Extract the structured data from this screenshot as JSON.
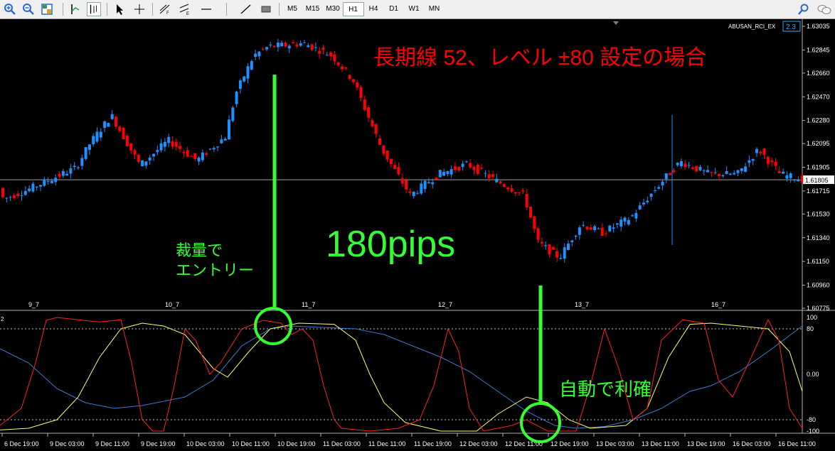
{
  "toolbar": {
    "timeframes": [
      "M5",
      "M15",
      "M30",
      "H1",
      "H4",
      "D1",
      "W1",
      "MN"
    ],
    "active_timeframe": "H1"
  },
  "indicator": {
    "name": "ABUSAN_RCI_EX",
    "value": "2.3"
  },
  "price_scale": [
    "1.63035",
    "1.62845",
    "1.62660",
    "1.62470",
    "1.62280",
    "1.62095",
    "1.61905",
    "1.61715",
    "1.61530",
    "1.61340",
    "1.61150",
    "1.60960",
    "1.60775"
  ],
  "current_price": "1.61805",
  "main_date_labels": [
    "9_7",
    "10_7",
    "11_7",
    "12_7",
    "13_7",
    "16_7"
  ],
  "sub_scale": [
    "100",
    "80",
    "0.00",
    "-80",
    "-100"
  ],
  "sub_left_label": "2",
  "time_labels": [
    "6 Dec 19:00",
    "9 Dec 03:00",
    "9 Dec 11:00",
    "9 Dec 19:00",
    "10 Dec 03:00",
    "10 Dec 11:00",
    "10 Dec 19:00",
    "11 Dec 03:00",
    "11 Dec 11:00",
    "11 Dec 19:00",
    "12 Dec 03:00",
    "12 Dec 11:00",
    "12 Dec 19:00",
    "13 Dec 03:00",
    "13 Dec 11:00",
    "13 Dec 19:00",
    "16 Dec 03:00",
    "16 Dec 11:00"
  ],
  "annotations": {
    "title": "長期線 52、レベル ±80 設定の場合",
    "entry_line1": "裁量で",
    "entry_line2": "エントリー",
    "pips": "180pips",
    "exit": "自動で利確"
  },
  "colors": {
    "bull": "#1e90ff",
    "bear": "#ff0000",
    "annotation_green": "#33ff33",
    "title_red": "#ff0000",
    "rci_short": "#ff2020",
    "rci_mid": "#ffff66",
    "rci_long": "#3a7bd5"
  }
}
